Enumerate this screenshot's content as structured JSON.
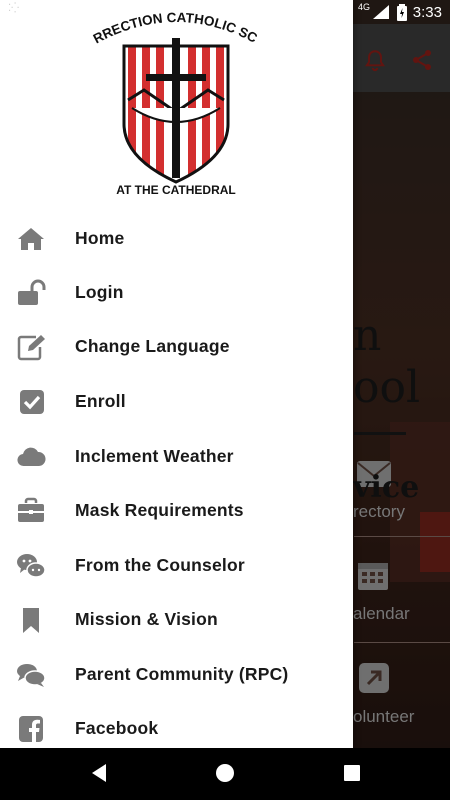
{
  "status_bar": {
    "network": "4G",
    "time": "3:33"
  },
  "logo": {
    "top_text": "RESURRECTION CATHOLIC SCHOOL",
    "bottom_text": "AT THE CATHEDRAL"
  },
  "menu": {
    "items": [
      {
        "label": "Home",
        "icon": "home-icon"
      },
      {
        "label": "Login",
        "icon": "unlock-icon"
      },
      {
        "label": "Change Language",
        "icon": "edit-icon"
      },
      {
        "label": "Enroll",
        "icon": "checkbox-icon"
      },
      {
        "label": "Inclement Weather",
        "icon": "cloud-icon"
      },
      {
        "label": "Mask Requirements",
        "icon": "briefcase-icon"
      },
      {
        "label": "From the Counselor",
        "icon": "wechat-icon"
      },
      {
        "label": "Mission & Vision",
        "icon": "bookmark-icon"
      },
      {
        "label": "Parent Community (RPC)",
        "icon": "comments-icon"
      },
      {
        "label": "Facebook",
        "icon": "facebook-icon"
      }
    ]
  },
  "background": {
    "title_line1": "n",
    "title_line2": "ool",
    "tiles": [
      "vice",
      "rectory",
      "alendar",
      "olunteer"
    ]
  },
  "colors": {
    "icon_gray": "#7a7a7a",
    "header_red": "#b3261e",
    "logo_red": "#d32f2f"
  }
}
